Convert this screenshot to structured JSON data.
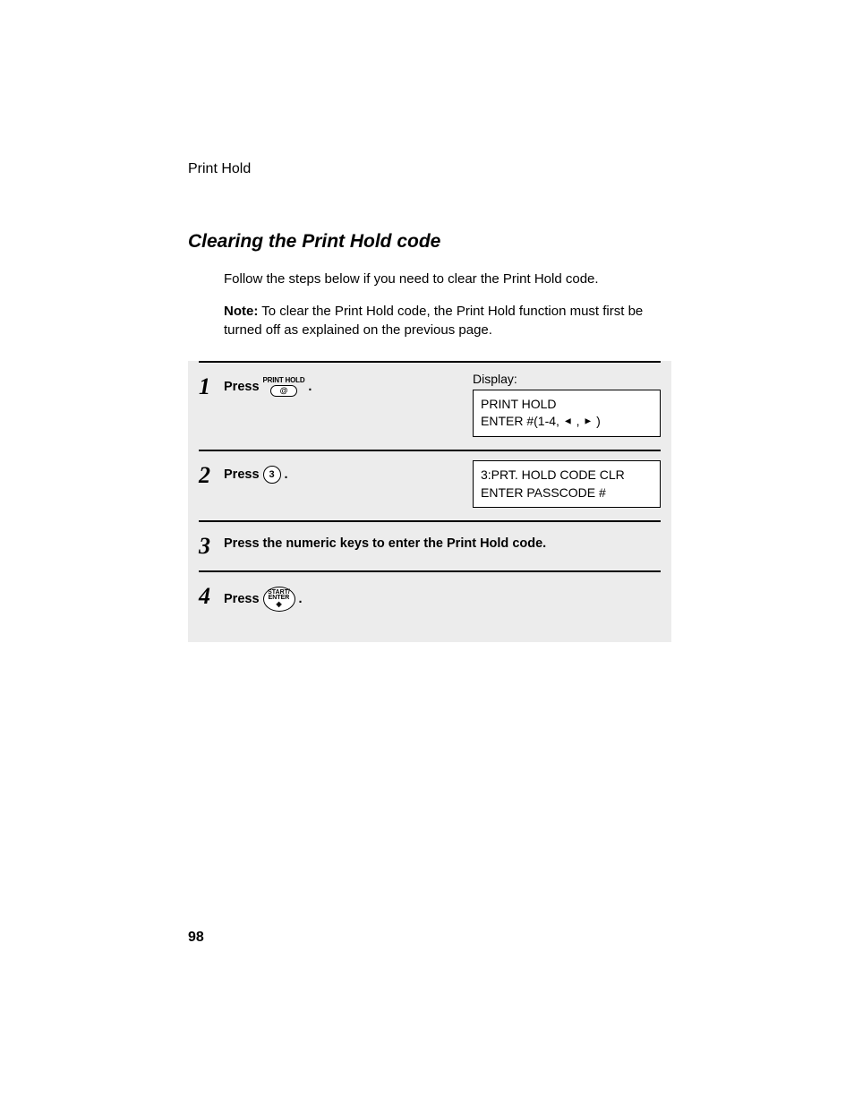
{
  "header": "Print Hold",
  "title": "Clearing the Print Hold code",
  "intro": "Follow the steps below if you need to clear the Print Hold code.",
  "noteLabel": "Note:",
  "noteText": " To clear the Print Hold code, the Print Hold function must first be turned off as explained on the previous page.",
  "displayLabel": "Display:",
  "steps": {
    "s1": {
      "num": "1",
      "press": "Press",
      "period": ".",
      "key": {
        "top": "PRINT HOLD",
        "btn": "@"
      },
      "display": {
        "line1": "PRINT HOLD",
        "line2a": "ENTER #(1-4, ",
        "line2b": " , ",
        "line2c": " )"
      }
    },
    "s2": {
      "num": "2",
      "press": "Press",
      "period": ".",
      "key": "3",
      "display": {
        "line1": "3:PRT. HOLD CODE CLR",
        "line2": "ENTER PASSCODE #"
      }
    },
    "s3": {
      "num": "3",
      "text": "Press the numeric keys to enter the Print Hold code."
    },
    "s4": {
      "num": "4",
      "press": "Press",
      "period": ".",
      "key": {
        "l1": "START/",
        "l2": "ENTER"
      }
    }
  },
  "pageNumber": "98"
}
